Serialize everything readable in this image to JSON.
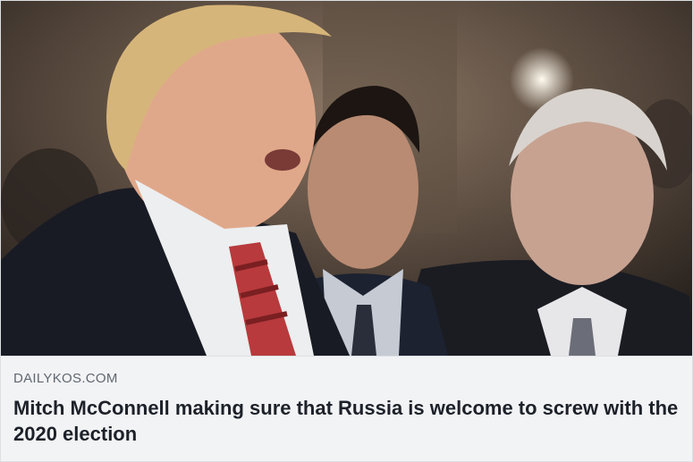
{
  "link_preview": {
    "domain": "DAILYKOS.COM",
    "headline": "Mitch McConnell making sure that Russia is welcome to screw with the 2020 election"
  },
  "colors": {
    "caption_background": "#f2f3f5",
    "domain_text": "#606770",
    "headline_text": "#1d2129"
  }
}
